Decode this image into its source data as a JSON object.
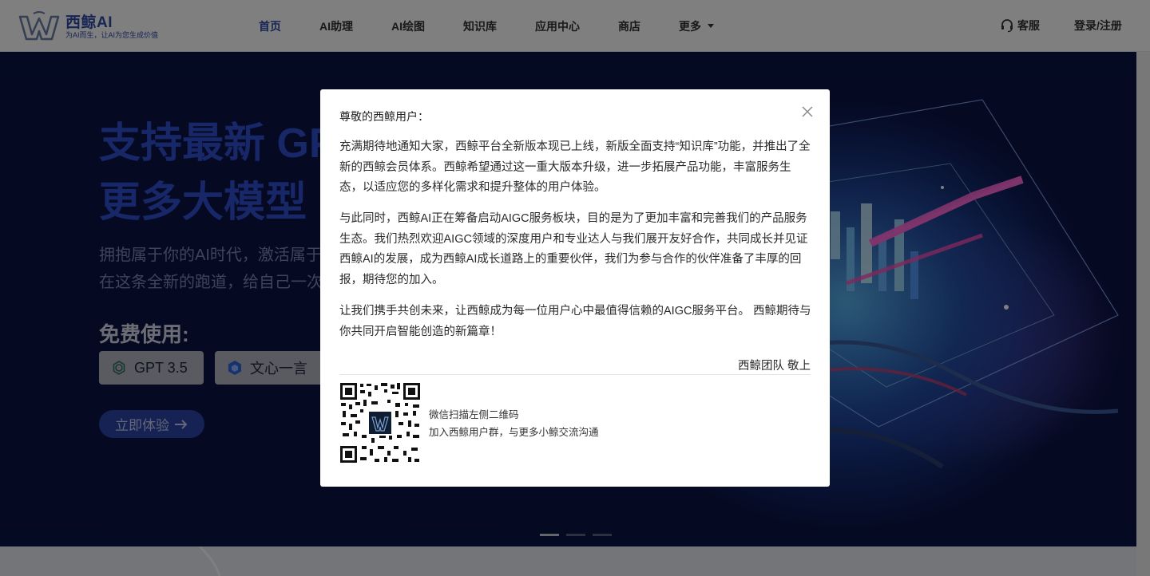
{
  "header": {
    "logo_name": "西鲸AI",
    "logo_slogan": "为AI而生，让AI为您生成价值",
    "nav": [
      {
        "label": "首页",
        "active": true
      },
      {
        "label": "AI助理"
      },
      {
        "label": "AI绘图"
      },
      {
        "label": "知识库"
      },
      {
        "label": "应用中心"
      },
      {
        "label": "商店"
      },
      {
        "label": "更多"
      }
    ],
    "support_label": "客服",
    "login_label": "登录/注册"
  },
  "hero": {
    "title_line1": "支持最新 GPT",
    "title_line2": "更多大模型",
    "desc_line1": "拥抱属于你的AI时代，激活属于你的生产力",
    "desc_line2": "在这条全新的跑道，给自己一次机会",
    "free_title": "免费使用:",
    "models": [
      "GPT 3.5",
      "文心一言"
    ],
    "cta_label": "立即体验",
    "carousel": {
      "count": 3,
      "active_index": 0
    }
  },
  "modal": {
    "greeting": "尊敬的西鲸用户：",
    "paragraphs": [
      "充满期待地通知大家，西鲸平台全新版本现已上线，新版全面支持“知识库”功能，并推出了全新的西鲸会员体系。西鲸希望通过这一重大版本升级，进一步拓展产品功能，丰富服务生态，以适应您的多样化需求和提升整体的用户体验。",
      "与此同时，西鲸AI正在筹备启动AIGC服务板块，目的是为了更加丰富和完善我们的产品服务生态。我们热烈欢迎AIGC领域的深度用户和专业达人与我们展开友好合作，共同成长并见证西鲸AI的发展，成为西鲸AI成长道路上的重要伙伴，我们为参与合作的伙伴准备了丰厚的回报，期待您的加入。",
      "让我们携手共创未来，让西鲸成为每一位用户心中最值得信赖的AIGC服务平台。 西鲸期待与你共同开启智能创造的新篇章！"
    ],
    "signature": "西鲸团队 敬上",
    "qr_line1": "微信扫描左侧二维码",
    "qr_line2": "加入西鲸用户群，与更多小鲸交流沟通"
  }
}
